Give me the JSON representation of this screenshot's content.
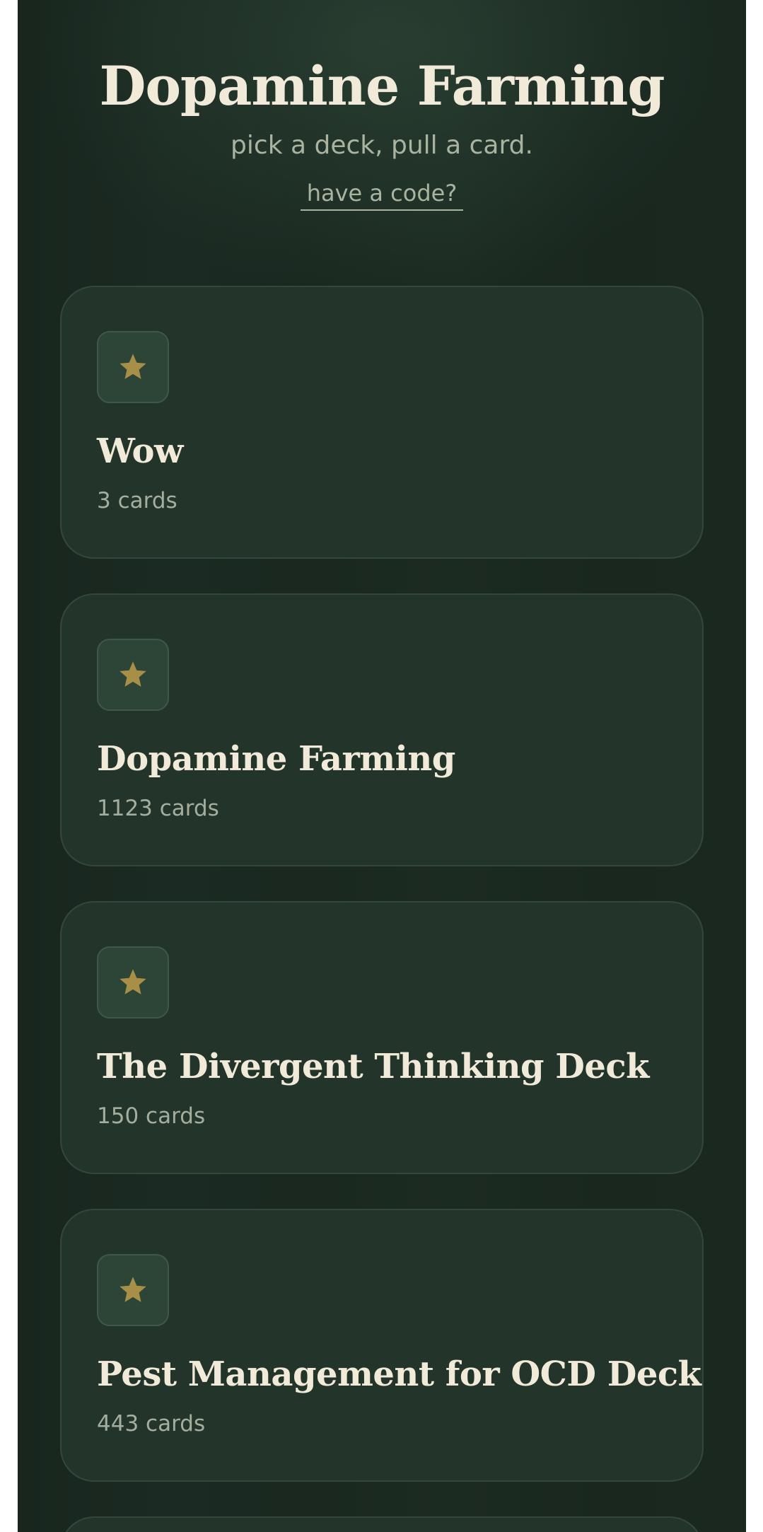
{
  "header": {
    "title": "Dopamine Farming",
    "subtitle": "pick a deck, pull a card.",
    "code_link": "have a code?"
  },
  "decks": [
    {
      "title": "Wow",
      "count": "3 cards",
      "icon": "star-icon"
    },
    {
      "title": "Dopamine Farming",
      "count": "1123 cards",
      "icon": "star-icon"
    },
    {
      "title": "The Divergent Thinking Deck",
      "count": "150 cards",
      "icon": "star-icon"
    },
    {
      "title": "Pest Management for OCD Deck",
      "count": "443 cards",
      "icon": "star-icon"
    }
  ],
  "colors": {
    "background": "#1a2820",
    "card": "#23352b",
    "star": "#a88f48",
    "title_text": "#f1ead8",
    "muted_text": "#a9b39f"
  }
}
